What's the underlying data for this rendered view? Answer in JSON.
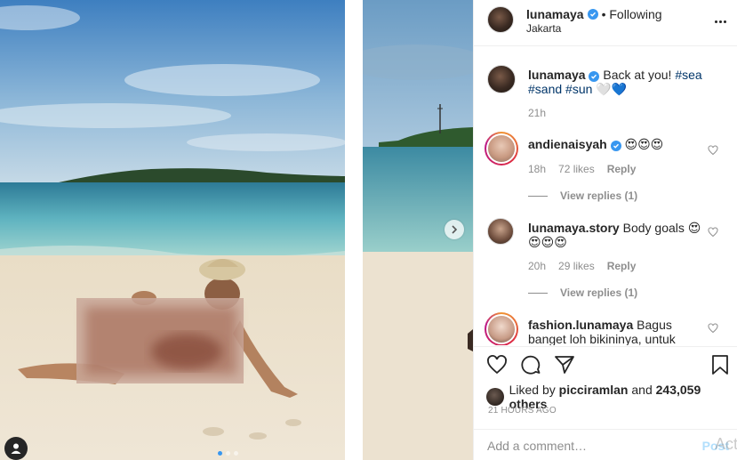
{
  "post": {
    "username": "lunamaya",
    "follow_status": "• Following",
    "location": "Jakarta",
    "caption_user": "lunamaya",
    "caption_text": "Back at you!",
    "caption_tags": [
      "#sea",
      "#sand",
      "#sun"
    ],
    "caption_emojis": "🤍💙",
    "caption_time": "21h"
  },
  "comments": [
    {
      "user": "andienaisyah",
      "text": "😍😍😍",
      "time": "18h",
      "likes": "72 likes",
      "reply": "Reply",
      "view_replies": "View replies (1)"
    },
    {
      "user": "lunamaya.story",
      "text": "Body goals 😍😍😍😍",
      "time": "20h",
      "likes": "29 likes",
      "reply": "Reply",
      "view_replies": "View replies (1)"
    },
    {
      "user": "fashion.lunamaya",
      "text": "Bagus banget loh bikininya, untuk yang"
    }
  ],
  "actions": {
    "liked_by_prefix": "Liked by",
    "liked_by_user": "picciramlan",
    "liked_by_and": "and",
    "liked_by_count": "243,059 others",
    "time_ago": "21 HOURS AGO",
    "comment_placeholder": "Add a comment…",
    "post_label": "Post",
    "watermark": "Act"
  },
  "colors": {
    "accent": "#3897f0",
    "hashtag": "#003569",
    "muted": "#8e8e8e"
  },
  "icons": [
    "more-icon",
    "verified-icon",
    "heart-icon",
    "comment-icon",
    "share-icon",
    "save-icon",
    "tag-user-icon",
    "next-arrow-icon"
  ]
}
